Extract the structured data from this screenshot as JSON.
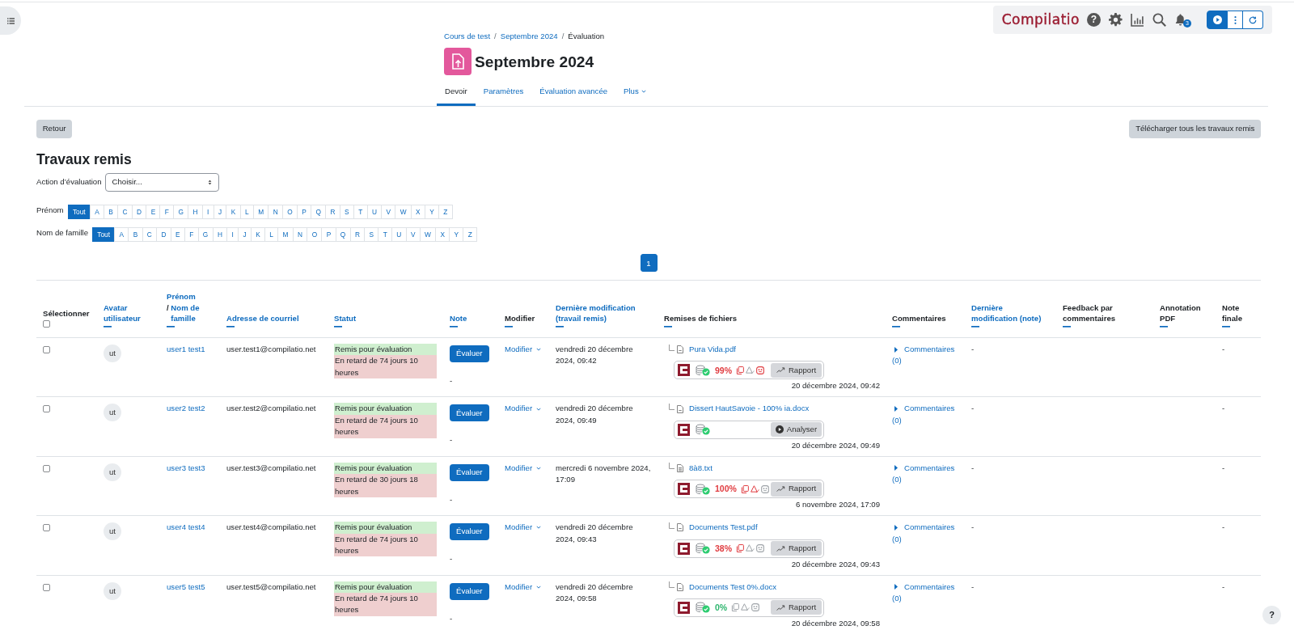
{
  "breadcrumb": [
    {
      "label": "Cours de test",
      "kind": "link"
    },
    {
      "label": "/",
      "kind": "separator"
    },
    {
      "label": "Septembre 2024",
      "kind": "link"
    },
    {
      "label": "/",
      "kind": "separator"
    },
    {
      "label": "Évaluation",
      "kind": "current"
    }
  ],
  "page_title": "Septembre 2024",
  "tabs": [
    {
      "label": "Devoir",
      "selected": true,
      "dropdown": false
    },
    {
      "label": "Paramètres",
      "selected": false,
      "dropdown": false
    },
    {
      "label": "Évaluation avancée",
      "selected": false,
      "dropdown": false
    },
    {
      "label": "Plus",
      "selected": false,
      "dropdown": true
    }
  ],
  "compilatio_bar": {
    "logo": "Compilatio",
    "help": "?",
    "notifications": "3"
  },
  "actions": {
    "back": "Retour",
    "download_all": "Télécharger tous les travaux remis"
  },
  "section_title": "Travaux remis",
  "grading_action": {
    "label": "Action d’évaluation",
    "value": "Choisir..."
  },
  "initials_filters": [
    {
      "label": "Prénom",
      "letters": [
        {
          "label": "Tout",
          "selected": true
        },
        {
          "label": "A",
          "selected": false
        },
        {
          "label": "B",
          "selected": false
        },
        {
          "label": "C",
          "selected": false
        },
        {
          "label": "D",
          "selected": false
        },
        {
          "label": "E",
          "selected": false
        },
        {
          "label": "F",
          "selected": false
        },
        {
          "label": "G",
          "selected": false
        },
        {
          "label": "H",
          "selected": false
        },
        {
          "label": "I",
          "selected": false
        },
        {
          "label": "J",
          "selected": false
        },
        {
          "label": "K",
          "selected": false
        },
        {
          "label": "L",
          "selected": false
        },
        {
          "label": "M",
          "selected": false
        },
        {
          "label": "N",
          "selected": false
        },
        {
          "label": "O",
          "selected": false
        },
        {
          "label": "P",
          "selected": false
        },
        {
          "label": "Q",
          "selected": false
        },
        {
          "label": "R",
          "selected": false
        },
        {
          "label": "S",
          "selected": false
        },
        {
          "label": "T",
          "selected": false
        },
        {
          "label": "U",
          "selected": false
        },
        {
          "label": "V",
          "selected": false
        },
        {
          "label": "W",
          "selected": false
        },
        {
          "label": "X",
          "selected": false
        },
        {
          "label": "Y",
          "selected": false
        },
        {
          "label": "Z",
          "selected": false
        }
      ]
    },
    {
      "label": "Nom de famille",
      "letters": [
        {
          "label": "Tout",
          "selected": true
        },
        {
          "label": "A",
          "selected": false
        },
        {
          "label": "B",
          "selected": false
        },
        {
          "label": "C",
          "selected": false
        },
        {
          "label": "D",
          "selected": false
        },
        {
          "label": "E",
          "selected": false
        },
        {
          "label": "F",
          "selected": false
        },
        {
          "label": "G",
          "selected": false
        },
        {
          "label": "H",
          "selected": false
        },
        {
          "label": "I",
          "selected": false
        },
        {
          "label": "J",
          "selected": false
        },
        {
          "label": "K",
          "selected": false
        },
        {
          "label": "L",
          "selected": false
        },
        {
          "label": "M",
          "selected": false
        },
        {
          "label": "N",
          "selected": false
        },
        {
          "label": "O",
          "selected": false
        },
        {
          "label": "P",
          "selected": false
        },
        {
          "label": "Q",
          "selected": false
        },
        {
          "label": "R",
          "selected": false
        },
        {
          "label": "S",
          "selected": false
        },
        {
          "label": "T",
          "selected": false
        },
        {
          "label": "U",
          "selected": false
        },
        {
          "label": "V",
          "selected": false
        },
        {
          "label": "W",
          "selected": false
        },
        {
          "label": "X",
          "selected": false
        },
        {
          "label": "Y",
          "selected": false
        },
        {
          "label": "Z",
          "selected": false
        }
      ]
    }
  ],
  "pagination": [
    {
      "label": "1",
      "selected": true
    }
  ],
  "table": {
    "columns": [
      {
        "kind": "select",
        "label": "Sélectionner",
        "checked": false
      },
      {
        "kind": "sortable",
        "label": "Avatar utilisateur"
      },
      {
        "kind": "name",
        "first": "Prénom",
        "separator": "/",
        "last": "Nom de famille"
      },
      {
        "kind": "sortable",
        "label": "Adresse de courriel"
      },
      {
        "kind": "sortable",
        "label": "Statut"
      },
      {
        "kind": "sortable",
        "label": "Note"
      },
      {
        "kind": "plain",
        "label": "Modifier"
      },
      {
        "kind": "sortable",
        "label": "Dernière modification (travail remis)"
      },
      {
        "kind": "plain",
        "label": "Remises de fichiers"
      },
      {
        "kind": "plain",
        "label": "Commentaires"
      },
      {
        "kind": "sortable",
        "label": "Dernière modification (note)"
      },
      {
        "kind": "plain",
        "label": "Feedback par commentaires"
      },
      {
        "kind": "plain",
        "label": "Annotation PDF"
      },
      {
        "kind": "plain",
        "label": "Note finale"
      }
    ],
    "rows": [
      {
        "selected": false,
        "avatar": "ut",
        "name": "user1 test1",
        "email": "user.test1@compilatio.net",
        "status": [
          {
            "text": "Remis pour évaluation",
            "kind": "submitted"
          },
          {
            "text": "En retard de 74 jours 10 heures",
            "kind": "late"
          }
        ],
        "grade_button": "Évaluer",
        "grade": "-",
        "edit": "Modifier",
        "modified": "vendredi 20 décembre 2024, 09:42",
        "file": {
          "name": "Pura Vida.pdf",
          "kind": "document"
        },
        "compilatio": {
          "score": {
            "text": "99%",
            "color": "#e03c40"
          },
          "indicators": [
            {
              "kind": "similarity",
              "alert": true
            },
            {
              "kind": "ai",
              "alert": false
            },
            {
              "kind": "characters",
              "alert": true
            }
          ],
          "action": {
            "kind": "report",
            "label": "Rapport"
          }
        },
        "submitted": "20 décembre 2024, 09:42",
        "comments": "Commentaires (0)",
        "grade_modified": "-",
        "final_grade": "-"
      },
      {
        "selected": false,
        "avatar": "ut",
        "name": "user2 test2",
        "email": "user.test2@compilatio.net",
        "status": [
          {
            "text": "Remis pour évaluation",
            "kind": "submitted"
          },
          {
            "text": "En retard de 74 jours 10 heures",
            "kind": "late"
          }
        ],
        "grade_button": "Évaluer",
        "grade": "-",
        "edit": "Modifier",
        "modified": "vendredi 20 décembre 2024, 09:49",
        "file": {
          "name": "Dissert HautSavoie - 100% ia.docx",
          "kind": "document"
        },
        "compilatio": {
          "action": {
            "kind": "analyze",
            "label": "Analyser"
          }
        },
        "submitted": "20 décembre 2024, 09:49",
        "comments": "Commentaires (0)",
        "grade_modified": "-",
        "final_grade": "-"
      },
      {
        "selected": false,
        "avatar": "ut",
        "name": "user3 test3",
        "email": "user.test3@compilatio.net",
        "status": [
          {
            "text": "Remis pour évaluation",
            "kind": "submitted"
          },
          {
            "text": "En retard de 30 jours 18 heures",
            "kind": "late"
          }
        ],
        "grade_button": "Évaluer",
        "grade": "-",
        "edit": "Modifier",
        "modified": "mercredi 6 novembre 2024, 17:09",
        "file": {
          "name": "8à8.txt",
          "kind": "text"
        },
        "compilatio": {
          "score": {
            "text": "100%",
            "color": "#e03c40"
          },
          "indicators": [
            {
              "kind": "similarity",
              "alert": true
            },
            {
              "kind": "ai",
              "alert": true
            },
            {
              "kind": "characters",
              "alert": false
            }
          ],
          "action": {
            "kind": "report",
            "label": "Rapport"
          }
        },
        "submitted": "6 novembre 2024, 17:09",
        "comments": "Commentaires (0)",
        "grade_modified": "-",
        "final_grade": "-"
      },
      {
        "selected": false,
        "avatar": "ut",
        "name": "user4 test4",
        "email": "user.test4@compilatio.net",
        "status": [
          {
            "text": "Remis pour évaluation",
            "kind": "submitted"
          },
          {
            "text": "En retard de 74 jours 10 heures",
            "kind": "late"
          }
        ],
        "grade_button": "Évaluer",
        "grade": "-",
        "edit": "Modifier",
        "modified": "vendredi 20 décembre 2024, 09:43",
        "file": {
          "name": "Documents Test.pdf",
          "kind": "document"
        },
        "compilatio": {
          "score": {
            "text": "38%",
            "color": "#e03c40"
          },
          "indicators": [
            {
              "kind": "similarity",
              "alert": true
            },
            {
              "kind": "ai",
              "alert": false
            },
            {
              "kind": "characters",
              "alert": false
            }
          ],
          "action": {
            "kind": "report",
            "label": "Rapport"
          }
        },
        "submitted": "20 décembre 2024, 09:43",
        "comments": "Commentaires (0)",
        "grade_modified": "-",
        "final_grade": "-"
      },
      {
        "selected": false,
        "avatar": "ut",
        "name": "user5 test5",
        "email": "user.test5@compilatio.net",
        "status": [
          {
            "text": "Remis pour évaluation",
            "kind": "submitted"
          },
          {
            "text": "En retard de 74 jours 10 heures",
            "kind": "late"
          }
        ],
        "grade_button": "Évaluer",
        "grade": "-",
        "edit": "Modifier",
        "modified": "vendredi 20 décembre 2024, 09:58",
        "file": {
          "name": "Documents Test 0%.docx",
          "kind": "document"
        },
        "compilatio": {
          "score": {
            "text": "0%",
            "color": "#2fb66f"
          },
          "indicators": [
            {
              "kind": "similarity",
              "alert": false
            },
            {
              "kind": "ai",
              "alert": false
            },
            {
              "kind": "characters",
              "alert": false
            }
          ],
          "action": {
            "kind": "report",
            "label": "Rapport"
          }
        },
        "submitted": "20 décembre 2024, 09:58",
        "comments": "Commentaires (0)",
        "grade_modified": "-",
        "final_grade": "-"
      }
    ]
  },
  "help_button": "?"
}
